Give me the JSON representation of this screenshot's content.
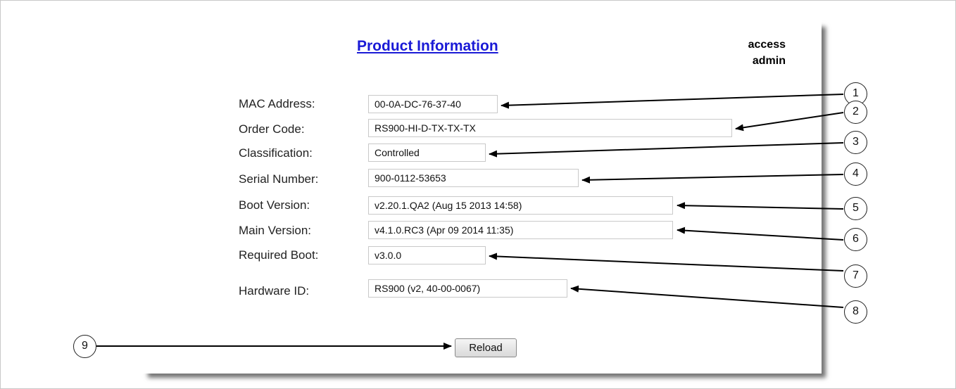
{
  "header": {
    "title": "Product Information",
    "access_label": "access",
    "access_level": "admin"
  },
  "fields": [
    {
      "label": "MAC Address:",
      "value": "00-0A-DC-76-37-40"
    },
    {
      "label": "Order Code:",
      "value": "RS900-HI-D-TX-TX-TX"
    },
    {
      "label": "Classification:",
      "value": "Controlled"
    },
    {
      "label": "Serial Number:",
      "value": "900-0112-53653"
    },
    {
      "label": "Boot Version:",
      "value": "v2.20.1.QA2 (Aug 15 2013 14:58)"
    },
    {
      "label": "Main Version:",
      "value": "v4.1.0.RC3 (Apr 09 2014 11:35)"
    },
    {
      "label": "Required Boot:",
      "value": "v3.0.0"
    },
    {
      "label": "Hardware ID:",
      "value": "RS900 (v2, 40-00-0067)"
    }
  ],
  "actions": {
    "reload_label": "Reload"
  },
  "callouts": [
    "1",
    "2",
    "3",
    "4",
    "5",
    "6",
    "7",
    "8",
    "9"
  ]
}
